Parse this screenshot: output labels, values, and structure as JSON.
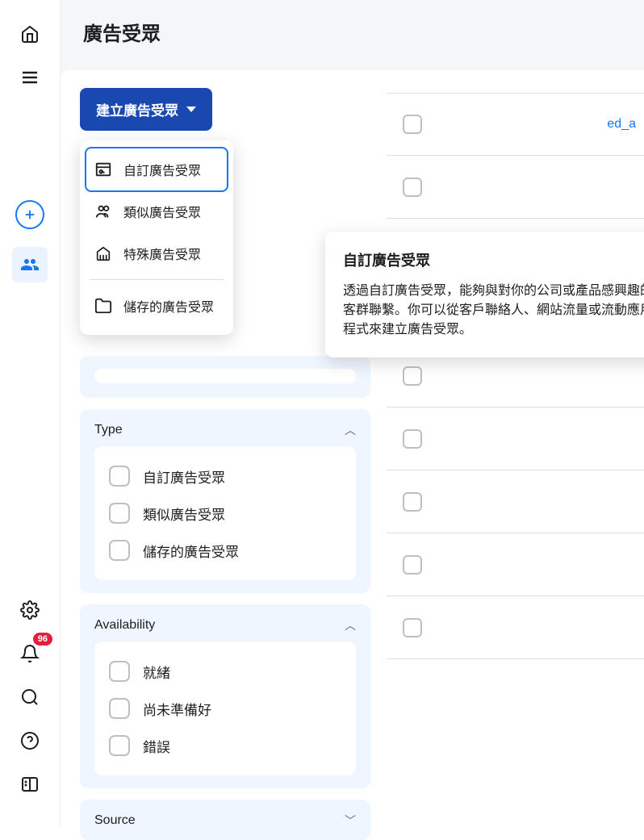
{
  "colors": {
    "primary": "#1848b0",
    "accent": "#1877f2",
    "badge": "#e41e3f"
  },
  "sidebar": {
    "badge_count": "96"
  },
  "header": {
    "title": "廣告受眾"
  },
  "create_button": {
    "label": "建立廣告受眾"
  },
  "dropdown": {
    "items": [
      {
        "label": "自訂廣告受眾",
        "selected": true
      },
      {
        "label": "類似廣告受眾",
        "selected": false
      },
      {
        "label": "特殊廣告受眾",
        "selected": false
      }
    ],
    "saved_label": "儲存的廣告受眾"
  },
  "tooltip": {
    "title": "自訂廣告受眾",
    "body": "透過自訂廣告受眾，能夠與對你的公司或產品感興趣的客群聯繫。你可以從客戶聯絡人、網站流量或流動應用程式來建立廣告受眾。"
  },
  "filters": {
    "type": {
      "title": "Type",
      "options": [
        "自訂廣告受眾",
        "類似廣告受眾",
        "儲存的廣告受眾"
      ]
    },
    "availability": {
      "title": "Availability",
      "options": [
        "就緒",
        "尚未準備好",
        "錯誤"
      ]
    },
    "source": {
      "title": "Source"
    }
  },
  "table": {
    "truncated_text": "ed_a"
  }
}
